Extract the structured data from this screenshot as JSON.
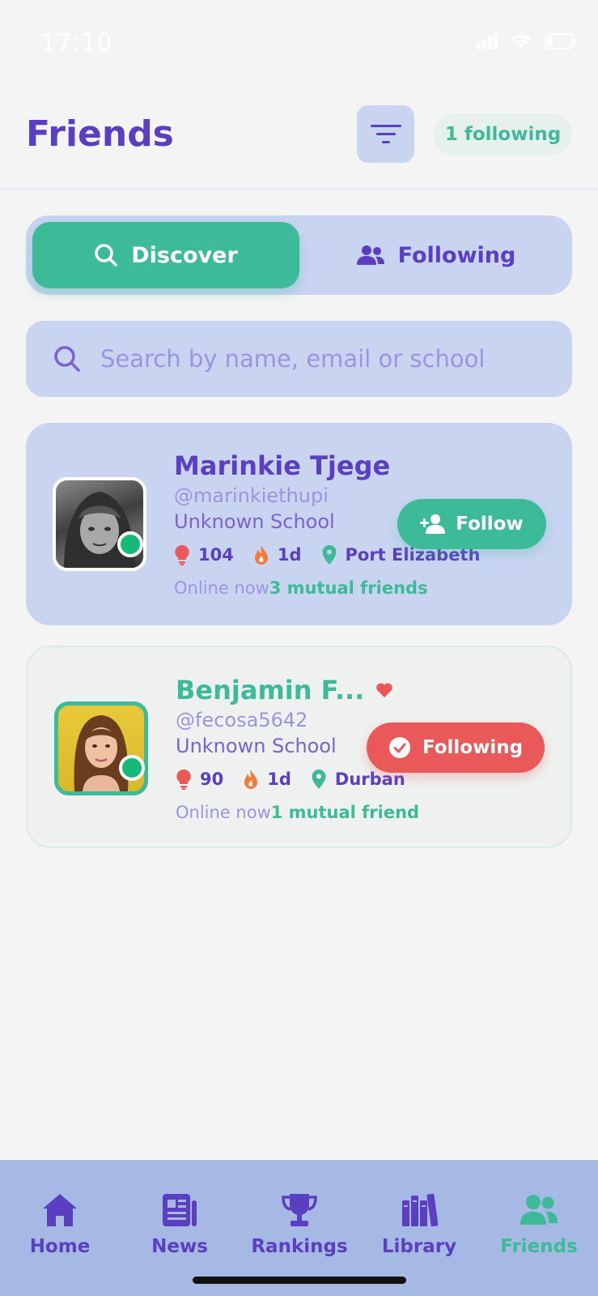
{
  "status_bar": {
    "time": "17:10"
  },
  "header": {
    "title": "Friends",
    "following_count": "1 following"
  },
  "segments": {
    "discover": "Discover",
    "following": "Following"
  },
  "search": {
    "placeholder": "Search by name, email or school"
  },
  "friends": [
    {
      "name": "Marinkie Tjege",
      "handle": "@marinkiethupi",
      "school": "Unknown School",
      "points": "104",
      "streak": "1d",
      "location": "Port Elizabeth",
      "online": "Online now",
      "mutual": "3 mutual friends",
      "action": "Follow"
    },
    {
      "name": "Benjamin F...",
      "handle": "@fecosa5642",
      "school": "Unknown School",
      "points": "90",
      "streak": "1d",
      "location": "Durban",
      "online": "Online now",
      "mutual": "1 mutual friend",
      "action": "Following"
    }
  ],
  "tabs": [
    {
      "label": "Home",
      "icon": "home-icon"
    },
    {
      "label": "News",
      "icon": "newspaper-icon"
    },
    {
      "label": "Rankings",
      "icon": "trophy-icon"
    },
    {
      "label": "Library",
      "icon": "books-icon"
    },
    {
      "label": "Friends",
      "icon": "users-icon",
      "active": true
    }
  ],
  "colors": {
    "primary": "#5a3fc0",
    "accent": "#3dba97",
    "danger": "#e95959",
    "card": "#c9d4f1",
    "tabbar": "#a6b9e4"
  }
}
